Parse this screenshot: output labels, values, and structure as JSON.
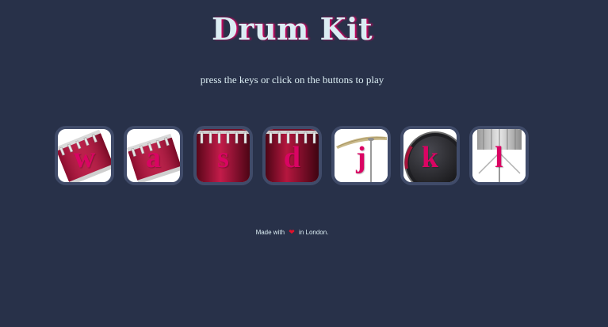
{
  "title": "Drum Kit",
  "subtitle": "press the keys or click on the buttons to play",
  "drums": [
    {
      "key": "w",
      "icon": "tom-drum-icon"
    },
    {
      "key": "a",
      "icon": "tom-drum-icon"
    },
    {
      "key": "s",
      "icon": "snare-drum-icon"
    },
    {
      "key": "d",
      "icon": "snare-drum-icon"
    },
    {
      "key": "j",
      "icon": "crash-cymbal-icon"
    },
    {
      "key": "k",
      "icon": "kick-drum-icon"
    },
    {
      "key": "l",
      "icon": "hi-hat-icon"
    }
  ],
  "footer": {
    "prefix": "Made with",
    "heart": "❤",
    "suffix": "in London."
  },
  "colors": {
    "background": "#283149",
    "button_border": "#404b69",
    "letter": "#da0463",
    "text": "#dbedf3"
  }
}
